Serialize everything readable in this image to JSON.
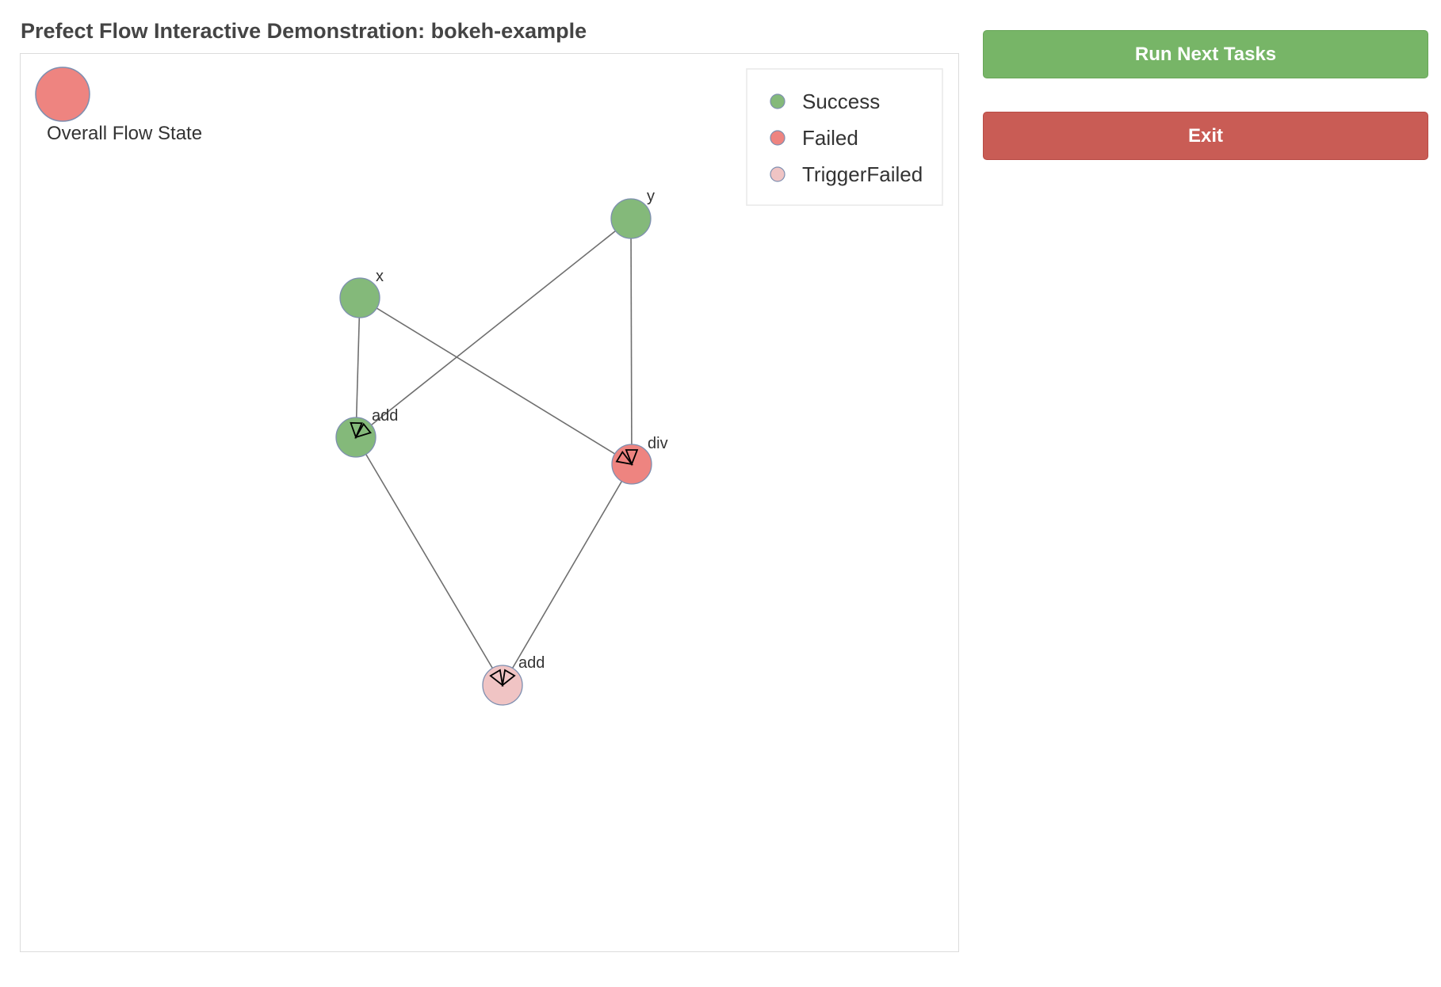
{
  "page": {
    "title": "Prefect Flow Interactive Demonstration: bokeh-example"
  },
  "controls": {
    "run_label": "Run Next Tasks",
    "exit_label": "Exit"
  },
  "colors": {
    "success": "#84b97a",
    "failed": "#ee8480",
    "trigger_failed": "#f0c4c4",
    "node_stroke": "#7e8fb0",
    "edge": "#6f6f6f",
    "run_button": "#77b567",
    "exit_button": "#c95c55"
  },
  "flow_state": {
    "label": "Overall Flow State",
    "state": "failed"
  },
  "legend": [
    {
      "label": "Success",
      "state": "success"
    },
    {
      "label": "Failed",
      "state": "failed"
    },
    {
      "label": "TriggerFailed",
      "state": "trigger_failed"
    }
  ],
  "graph": {
    "nodes": [
      {
        "id": "x",
        "label": "x",
        "state": "success"
      },
      {
        "id": "y",
        "label": "y",
        "state": "success"
      },
      {
        "id": "add1",
        "label": "add",
        "state": "success"
      },
      {
        "id": "div",
        "label": "div",
        "state": "failed"
      },
      {
        "id": "add2",
        "label": "add",
        "state": "trigger_failed"
      }
    ],
    "edges": [
      {
        "from": "x",
        "to": "add1"
      },
      {
        "from": "y",
        "to": "add1"
      },
      {
        "from": "x",
        "to": "div"
      },
      {
        "from": "y",
        "to": "div"
      },
      {
        "from": "add1",
        "to": "add2"
      },
      {
        "from": "div",
        "to": "add2"
      }
    ]
  }
}
